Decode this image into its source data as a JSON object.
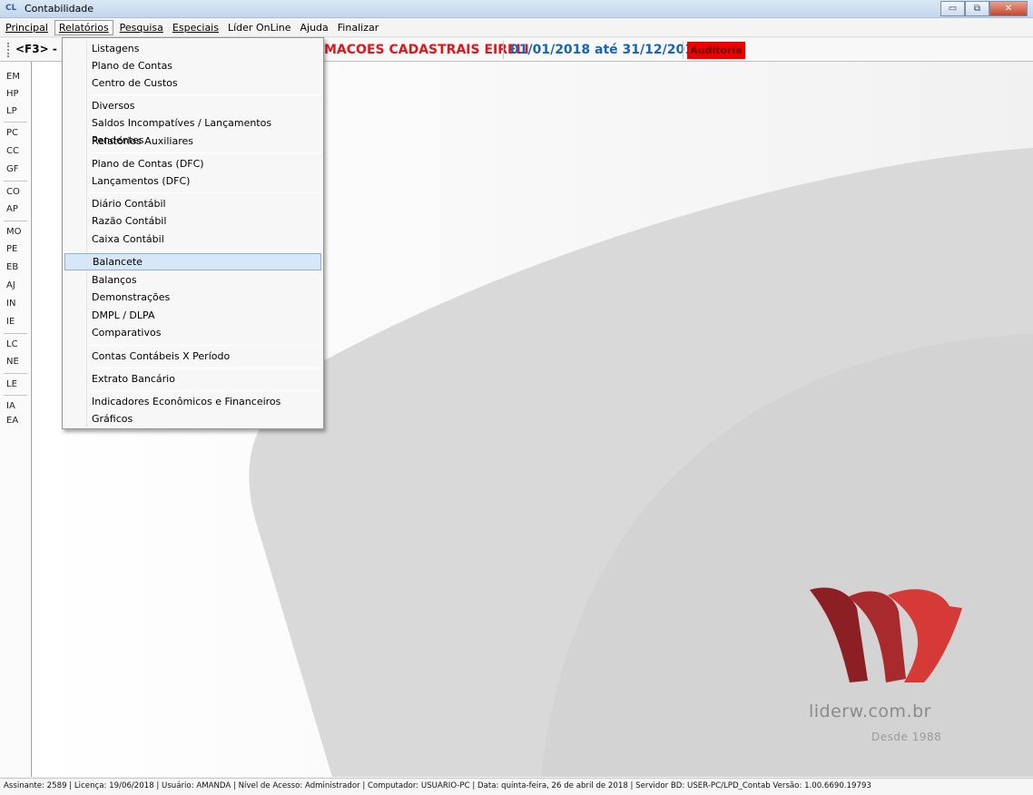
{
  "window": {
    "title": "Contabilidade",
    "app_icon": "CL"
  },
  "window_buttons": {
    "minimize": "▭",
    "maximize": "⧉",
    "close": "✕"
  },
  "menubar": {
    "items": [
      "Principal",
      "Relatórios",
      "Pesquisa",
      "Especiais",
      "Líder OnLine",
      "Ajuda",
      "Finalizar"
    ]
  },
  "infobar": {
    "shortcut": "<F3> - E",
    "company": "MACOES CADASTRAIS EIRELI",
    "period": "01/01/2018 até 31/12/2018",
    "audit": "Auditoria",
    "audit_color": "#f20000",
    "company_color": "#e0161b",
    "period_color": "#1765b5"
  },
  "sidebar": {
    "items": [
      "EM",
      "HP",
      "LP",
      "PC",
      "CC",
      "GF",
      "CO",
      "AP",
      "MO",
      "PE",
      "EB",
      "AJ",
      "IN",
      "IE",
      "LC",
      "NE",
      "LE",
      "IA",
      "EA"
    ]
  },
  "dropdown": {
    "items": [
      "Listagens",
      "Plano de Contas",
      "Centro de Custos",
      "Diversos",
      "Saldos Incompatíves / Lançamentos Pendentes",
      "Relatórios Auxiliares",
      "Plano de Contas (DFC)",
      "Lançamentos (DFC)",
      "Diário Contábil",
      "Razão Contábil",
      "Caixa Contábil",
      "Balancete",
      "Balanços",
      "Demonstrações",
      "DMPL / DLPA",
      "Comparativos",
      "Contas Contábeis X Período",
      "Extrato Bancário",
      "Indicadores Econômicos e Financeiros",
      "Gráficos"
    ],
    "highlighted": "Balancete"
  },
  "logo": {
    "text": "liderw.com.br",
    "subtitle": "Desde 1988",
    "colors": [
      "#8c1f24",
      "#d63a37"
    ]
  },
  "statusbar": {
    "text": "Assinante: 2589 | Licença: 19/06/2018 | Usuário: AMANDA | Nível de Acesso: Administrador | Computador: USUARIO-PC | Data: quinta-feira, 26 de abril de 2018 | Servidor BD: USER-PC/LPD_Contab  Versão: 1.00.6690.19793"
  }
}
